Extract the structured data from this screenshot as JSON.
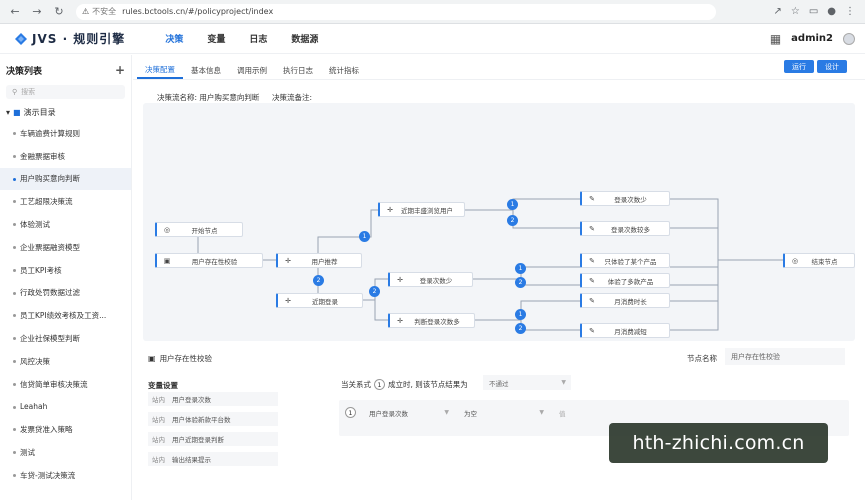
{
  "browser": {
    "security_label": "不安全",
    "url": "rules.bctools.cn/#/policyproject/index"
  },
  "app": {
    "logo_text": "JVS · 规则引擎",
    "nav": [
      {
        "label": "决策",
        "active": true
      },
      {
        "label": "变量",
        "active": false
      },
      {
        "label": "日志",
        "active": false
      },
      {
        "label": "数据源",
        "active": false
      }
    ],
    "username": "admin2"
  },
  "sidebar": {
    "title": "决策列表",
    "search_placeholder": "搜索",
    "group_label": "演示目录",
    "items": [
      {
        "label": "车辆逾费计算规则",
        "active": false
      },
      {
        "label": "金融票据审核",
        "active": false
      },
      {
        "label": "用户购买意向判断",
        "active": true
      },
      {
        "label": "工艺超限决策流",
        "active": false
      },
      {
        "label": "体验测试",
        "active": false
      },
      {
        "label": "企业票据融资模型",
        "active": false
      },
      {
        "label": "员工KPI考核",
        "active": false
      },
      {
        "label": "行政处罚数据过滤",
        "active": false
      },
      {
        "label": "员工KPI绩效考核及工资...",
        "active": false
      },
      {
        "label": "企业社保模型判断",
        "active": false
      },
      {
        "label": "风控决策",
        "active": false
      },
      {
        "label": "信贷简单审核决策流",
        "active": false
      },
      {
        "label": "Leahah",
        "active": false
      },
      {
        "label": "发票贷准入策略",
        "active": false
      },
      {
        "label": "测试",
        "active": false
      },
      {
        "label": "车贷-测试决策流",
        "active": false
      }
    ]
  },
  "main": {
    "tabs": [
      {
        "label": "决策配置",
        "active": true
      },
      {
        "label": "基本信息",
        "active": false
      },
      {
        "label": "调用示例",
        "active": false
      },
      {
        "label": "执行日志",
        "active": false
      },
      {
        "label": "统计指标",
        "active": false
      }
    ],
    "run_label": "运行",
    "design_label": "设计",
    "flow_name_label": "决策流名称: 用户购买意向判断",
    "flow_note_label": "决策流备注:"
  },
  "flow": {
    "nodes": {
      "start": "开始节点",
      "user_check": "用户存在性校验",
      "user_recommend": "用户推荐",
      "recent_login": "近期登录",
      "recent_view": "近期丰盛浏览用户",
      "login_count_a": "登录次数少",
      "judge_login": "判断登录次数多",
      "login_few": "登录次数少",
      "login_many": "登录次数较多",
      "view_some": "只体验了某个产品",
      "view_multi": "体验了多款产品",
      "monthly_long": "月消费时长",
      "monthly_short": "月消费减短",
      "end": "结束节点"
    },
    "badges": [
      "1",
      "2",
      "1",
      "2",
      "1",
      "2",
      "1",
      "2"
    ]
  },
  "panel": {
    "title": "用户存在性校验",
    "node_name_label": "节点名称",
    "node_name_value": "用户存在性校验",
    "var_title": "变量设置",
    "variables": [
      {
        "tag": "站内",
        "name": "用户登录次数"
      },
      {
        "tag": "站内",
        "name": "用户体验新款平台数"
      },
      {
        "tag": "站内",
        "name": "用户近期登录判断"
      },
      {
        "tag": "站内",
        "name": "输出结果提示"
      }
    ],
    "cond_prefix": "当关系式",
    "cond_num": "1",
    "cond_suffix": "成立时, 则该节点结果为",
    "cond_select": "不通过",
    "rule": {
      "num": "1",
      "field": "用户登录次数",
      "op": "为空",
      "value": "值"
    }
  },
  "watermark": "hth-zhichi.com.cn"
}
